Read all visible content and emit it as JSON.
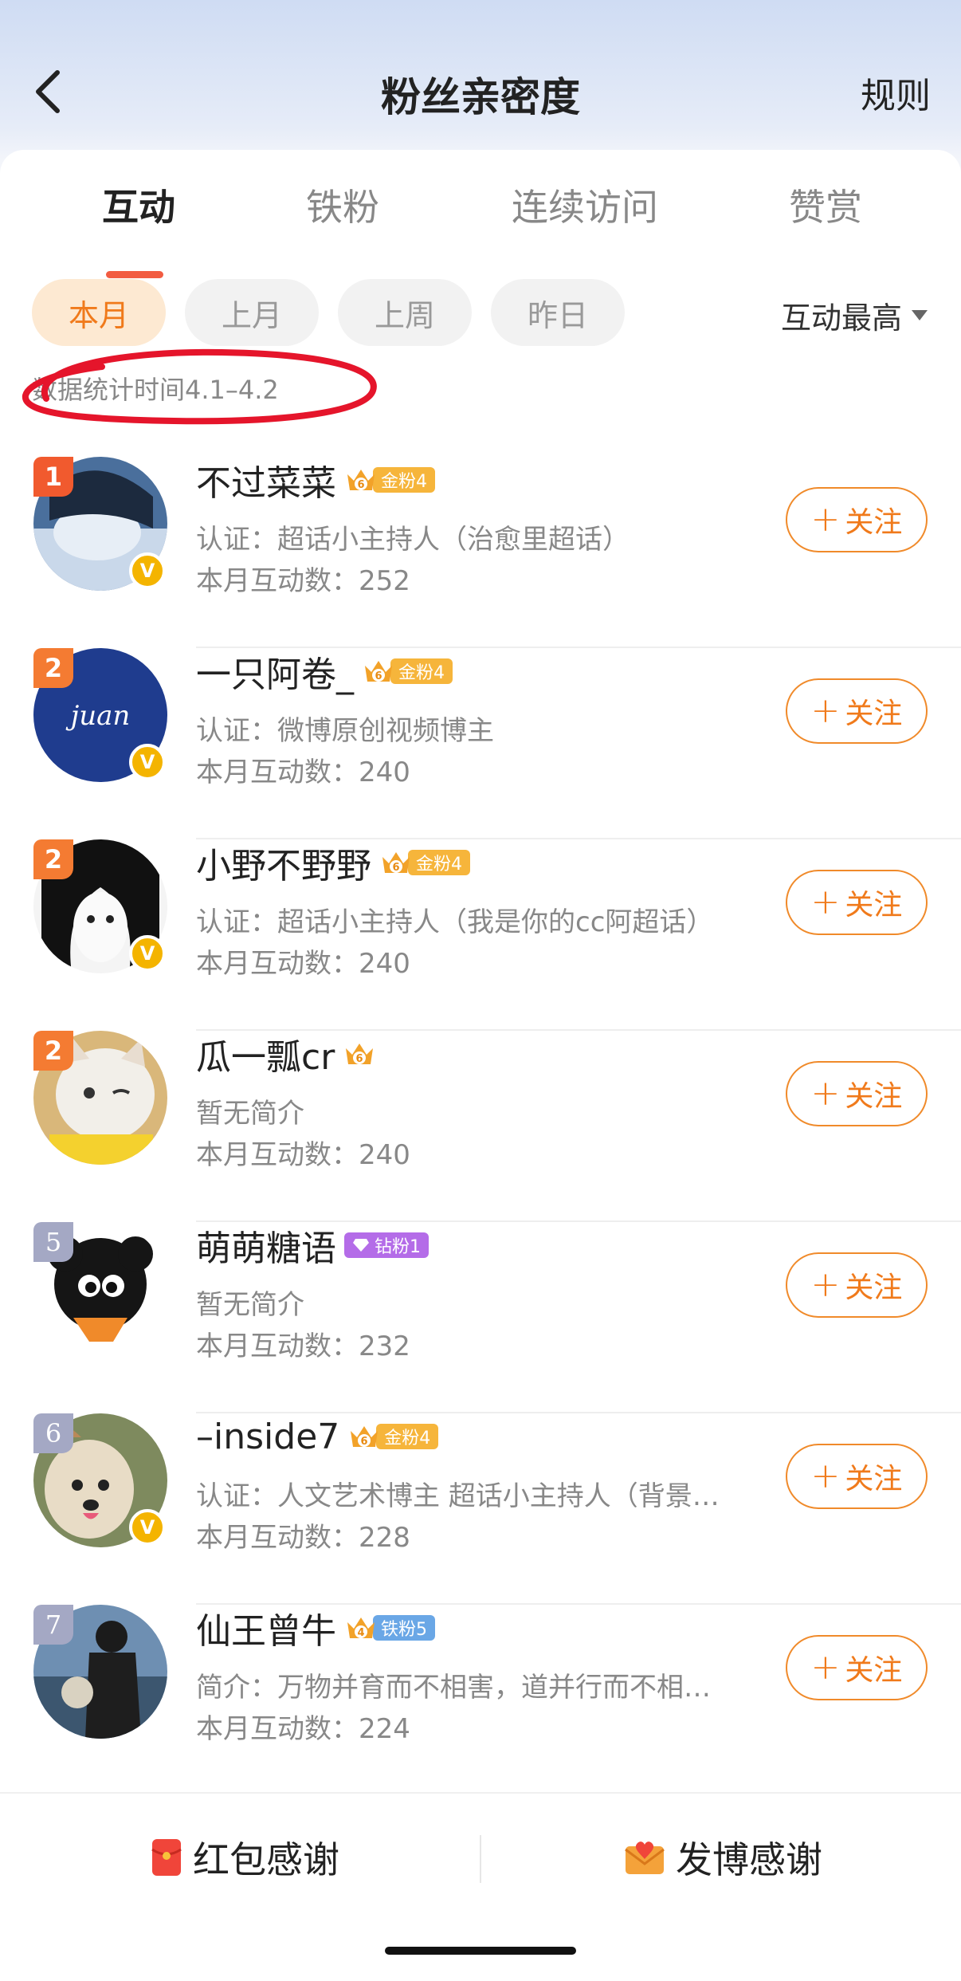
{
  "header": {
    "title": "粉丝亲密度",
    "rules": "规则",
    "back_icon": "chevron-left-icon"
  },
  "tabs": [
    {
      "label": "互动",
      "active": true
    },
    {
      "label": "铁粉",
      "active": false
    },
    {
      "label": "连续访问",
      "active": false
    },
    {
      "label": "赞赏",
      "active": false
    }
  ],
  "chips": [
    {
      "label": "本月",
      "active": true
    },
    {
      "label": "上月",
      "active": false
    },
    {
      "label": "上周",
      "active": false
    },
    {
      "label": "昨日",
      "active": false
    }
  ],
  "sort": {
    "label": "互动最高"
  },
  "stat_time": "数据统计时间4.1–4.2",
  "fans": [
    {
      "rank": "1",
      "name": "不过菜菜",
      "badge_level": "6",
      "badge_text": "金粉4",
      "badge_type": "gold",
      "desc": "认证：超话小主持人（治愈里超话）",
      "count": "本月互动数：252",
      "verified": true,
      "follow": "关注"
    },
    {
      "rank": "2",
      "name": "一只阿卷_",
      "badge_level": "6",
      "badge_text": "金粉4",
      "badge_type": "gold",
      "desc": "认证：微博原创视频博主",
      "count": "本月互动数：240",
      "verified": true,
      "follow": "关注"
    },
    {
      "rank": "2",
      "name": "小野不野野",
      "badge_level": "6",
      "badge_text": "金粉4",
      "badge_type": "gold",
      "desc": "认证：超话小主持人（我是你的cc阿超话）",
      "count": "本月互动数：240",
      "verified": true,
      "follow": "关注"
    },
    {
      "rank": "2",
      "name": "瓜一瓢cr",
      "badge_level": "6",
      "badge_text": "",
      "badge_type": "gold",
      "desc": "暂无简介",
      "count": "本月互动数：240",
      "verified": false,
      "follow": "关注"
    },
    {
      "rank": "5",
      "name": "萌萌糖语",
      "badge_level": "",
      "badge_text": "钻粉1",
      "badge_type": "diamond",
      "desc": "暂无简介",
      "count": "本月互动数：232",
      "verified": false,
      "follow": "关注"
    },
    {
      "rank": "6",
      "name": "–inside7",
      "badge_level": "6",
      "badge_text": "金粉4",
      "badge_type": "gold",
      "desc": "认证：人文艺术博主 超话小主持人（背景…",
      "count": "本月互动数：228",
      "verified": true,
      "follow": "关注"
    },
    {
      "rank": "7",
      "name": "仙王曾牛",
      "badge_level": "4",
      "badge_text": "铁粉5",
      "badge_type": "iron",
      "desc": "简介：万物并育而不相害，道并行而不相…",
      "count": "本月互动数：224",
      "verified": false,
      "follow": "关注"
    }
  ],
  "bottom": {
    "red_packet": "红包感谢",
    "post_thanks": "发博感谢"
  },
  "colors": {
    "accent": "#f07a1b",
    "tab_underline": "#f25c41",
    "annotation": "#e5152b"
  }
}
